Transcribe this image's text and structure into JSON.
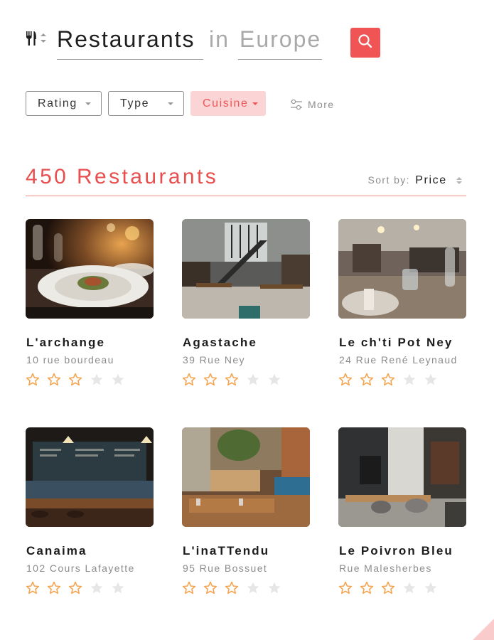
{
  "search": {
    "what": "Restaurants",
    "connector": "in",
    "where": "Europe"
  },
  "filters": {
    "rating": "Rating",
    "type": "Type",
    "cuisine": "Cuisine",
    "more": "More"
  },
  "results": {
    "count_label": "450 Restaurants",
    "sort_label": "Sort by:",
    "sort_value": "Price"
  },
  "colors": {
    "accent": "#f05454",
    "accent_light": "#fbd5d5",
    "star_filled": "#f5a14a",
    "star_empty": "#e6e6e6"
  },
  "restaurants": [
    {
      "name": "L'archange",
      "address": "10 rue bourdeau",
      "rating": 3,
      "max_rating": 5,
      "photo": "plated-dish-photo"
    },
    {
      "name": "Agastache",
      "address": "39 Rue Ney",
      "rating": 3,
      "max_rating": 5,
      "photo": "industrial-dining-hall-photo"
    },
    {
      "name": "Le ch'ti Pot Ney",
      "address": "24 Rue René Leynaud",
      "rating": 3,
      "max_rating": 5,
      "photo": "table-setting-photo"
    },
    {
      "name": "Canaima",
      "address": "102 Cours Lafayette",
      "rating": 3,
      "max_rating": 5,
      "photo": "bar-counter-photo"
    },
    {
      "name": "L'inaTTendu",
      "address": "95 Rue Bossuet",
      "rating": 3,
      "max_rating": 5,
      "photo": "brick-dining-room-photo"
    },
    {
      "name": "Le Poivron Bleu",
      "address": "Rue Malesherbes",
      "rating": 3,
      "max_rating": 5,
      "photo": "modern-dining-room-photo"
    }
  ]
}
